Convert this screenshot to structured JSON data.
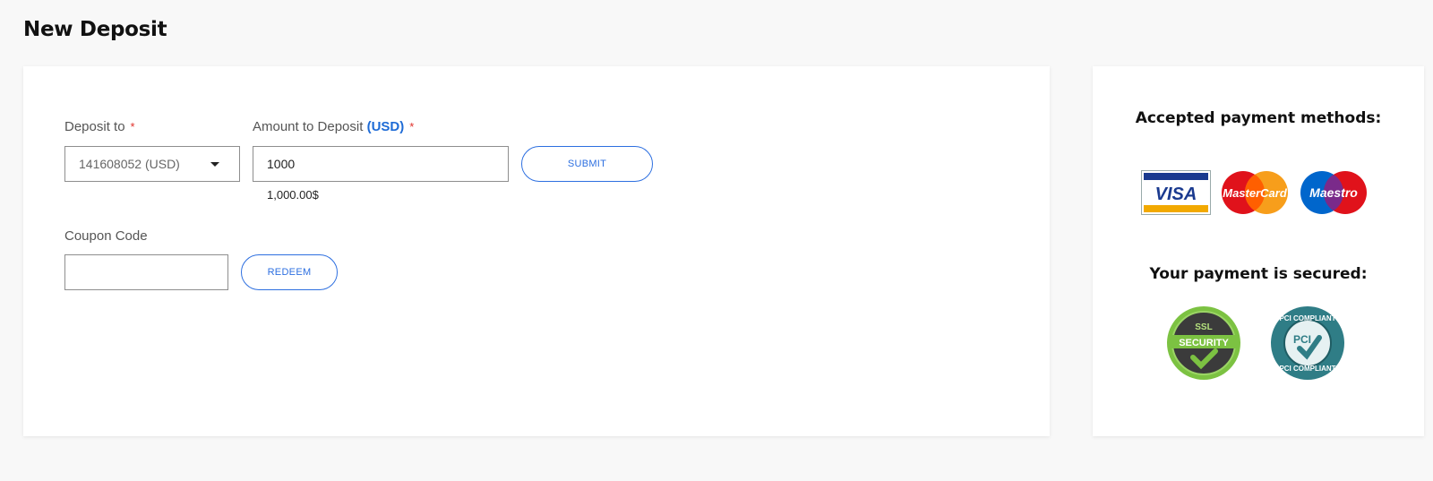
{
  "page": {
    "title": "New Deposit"
  },
  "form": {
    "deposit_to": {
      "label": "Deposit to",
      "required_mark": "*",
      "value": "141608052 (USD)"
    },
    "amount": {
      "label": "Amount to Deposit",
      "currency": "(USD)",
      "required_mark": "*",
      "value": "1000",
      "formatted": "1,000.00$"
    },
    "submit_label": "SUBMIT",
    "coupon": {
      "label": "Coupon Code",
      "value": ""
    },
    "redeem_label": "REDEEM"
  },
  "side": {
    "methods_heading": "Accepted payment methods:",
    "visa_text": "VISA",
    "mastercard_text": "MasterCard",
    "maestro_text": "Maestro",
    "secured_heading": "Your payment is secured:",
    "ssl_top": "SSL",
    "ssl_band": "SECURITY",
    "pci_top": "PCI COMPLIANT",
    "pci_mid": "PCI",
    "pci_bottom": "PCI COMPLIANT"
  },
  "colors": {
    "accent": "#2d6fe0",
    "required": "#e0312b",
    "visa_blue": "#1a3a8f",
    "visa_gold": "#f2a900",
    "mc_red": "#e0121b",
    "mc_yellow": "#f79e1b",
    "maestro_blue": "#0066cc",
    "ssl_green": "#7cc242",
    "pci_teal": "#2f7d86"
  }
}
